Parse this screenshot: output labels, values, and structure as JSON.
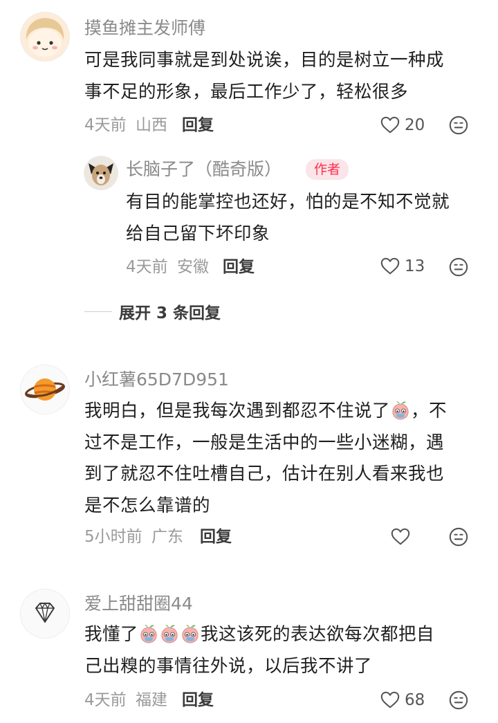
{
  "comments": [
    {
      "username": "摸鱼摊主发师傅",
      "lines": [
        "可是我同事就是到处说诶，目的是树立一种成",
        "事不足的形象，最后工作少了，轻松很多"
      ],
      "time": "4天前",
      "location": "山西",
      "reply_label": "回复",
      "likes": "20",
      "avatar_icon": "cartoon-girl-icon"
    },
    {
      "username": "长脑子了（酷奇版）",
      "badge": "作者",
      "lines": [
        "有目的能掌控也还好，怕的是不知不觉就",
        "给自己留下坏印象"
      ],
      "time": "4天前",
      "location": "安徽",
      "reply_label": "回复",
      "likes": "13",
      "avatar_icon": "dog-icon"
    },
    {
      "username": "小红薯65D7D951",
      "lines": [
        "我明白，但是我每次遇到都忍不住说了",
        "，不",
        "过不是工作，一般是生活中的一些小迷糊，遇",
        "到了就忍不住吐槽自己，估计在别人看来我也",
        "是不怎么靠谱的"
      ],
      "time": "5小时前",
      "location": "广东",
      "reply_label": "回复",
      "likes": "",
      "avatar_icon": "planet-icon"
    },
    {
      "username": "爱上甜甜圈44",
      "lines": [
        "我懂了",
        "我这该死的表达欲每次都把自",
        "己出糗的事情往外说，以后我不讲了"
      ],
      "time": "4天前",
      "location": "福建",
      "reply_label": "回复",
      "likes": "68",
      "avatar_icon": "diamond-icon"
    }
  ],
  "expand_replies": "展开 3 条回复",
  "colors": {
    "author_badge_bg": "#fbe5e8",
    "author_badge_text": "#ff2e4d"
  }
}
